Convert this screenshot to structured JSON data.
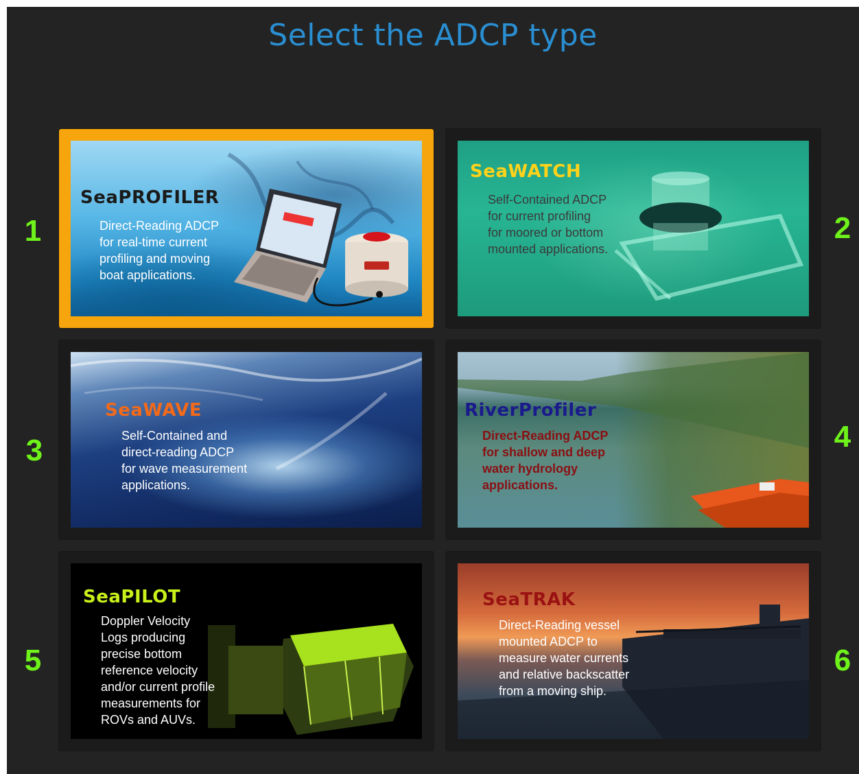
{
  "page": {
    "title": "Select the ADCP type"
  },
  "colors": {
    "background": "#232323",
    "title": "#2a8fd2",
    "number": "#6ef21a",
    "selected_border": "#f7a50c"
  },
  "cards": [
    {
      "number": "1",
      "name": "SeaPROFILER",
      "name_color": "#1a1a1a",
      "desc_color": "#ffffff",
      "description": "Direct-Reading ADCP\nfor real-time current\nprofiling and moving\nboat applications.",
      "selected": true
    },
    {
      "number": "2",
      "name": "SeaWATCH",
      "name_color": "#ffd21a",
      "desc_color": "#3a3a3a",
      "description": "Self-Contained ADCP\nfor current profiling\nfor moored or bottom\nmounted applications.",
      "selected": false
    },
    {
      "number": "3",
      "name": "SeaWAVE",
      "name_color": "#f26a1a",
      "desc_color": "#ffffff",
      "description": "Self-Contained and\ndirect-reading ADCP\nfor wave measurement\napplications.",
      "selected": false
    },
    {
      "number": "4",
      "name": "RiverProfiler",
      "name_color": "#1a1a8c",
      "desc_color": "#8a0f12",
      "description": "Direct-Reading ADCP\nfor shallow and deep\nwater hydrology\napplications.",
      "selected": false
    },
    {
      "number": "5",
      "name": "SeaPILOT",
      "name_color": "#c8f01a",
      "desc_color": "#ffffff",
      "description": "Doppler Velocity\nLogs producing\nprecise bottom\nreference velocity\nand/or current profile\nmeasurements for\nROVs and AUVs.",
      "selected": false
    },
    {
      "number": "6",
      "name": "SeaTRAK",
      "name_color": "#9a1212",
      "desc_color": "#ffffff",
      "description": "Direct-Reading vessel\nmounted ADCP to\nmeasure water currents\nand relative backscatter\nfrom a moving ship.",
      "selected": false
    }
  ]
}
